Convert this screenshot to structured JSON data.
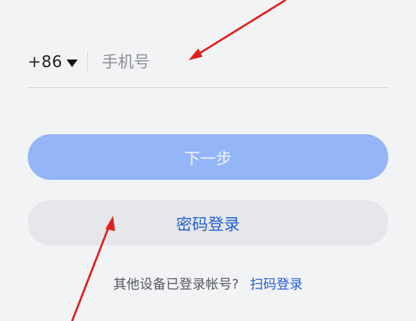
{
  "phone": {
    "country_code": "+86",
    "placeholder": "手机号",
    "value": ""
  },
  "buttons": {
    "next_label": "下一步",
    "password_login_label": "密码登录"
  },
  "footer": {
    "prompt": "其他设备已登录帐号?",
    "scan_login_label": "扫码登录"
  },
  "colors": {
    "background": "#f2f3f5",
    "next_button": "#94b5f8",
    "secondary_button": "#e6e7ea",
    "link": "#1d5fd6",
    "annotation_arrow": "#e02020"
  }
}
